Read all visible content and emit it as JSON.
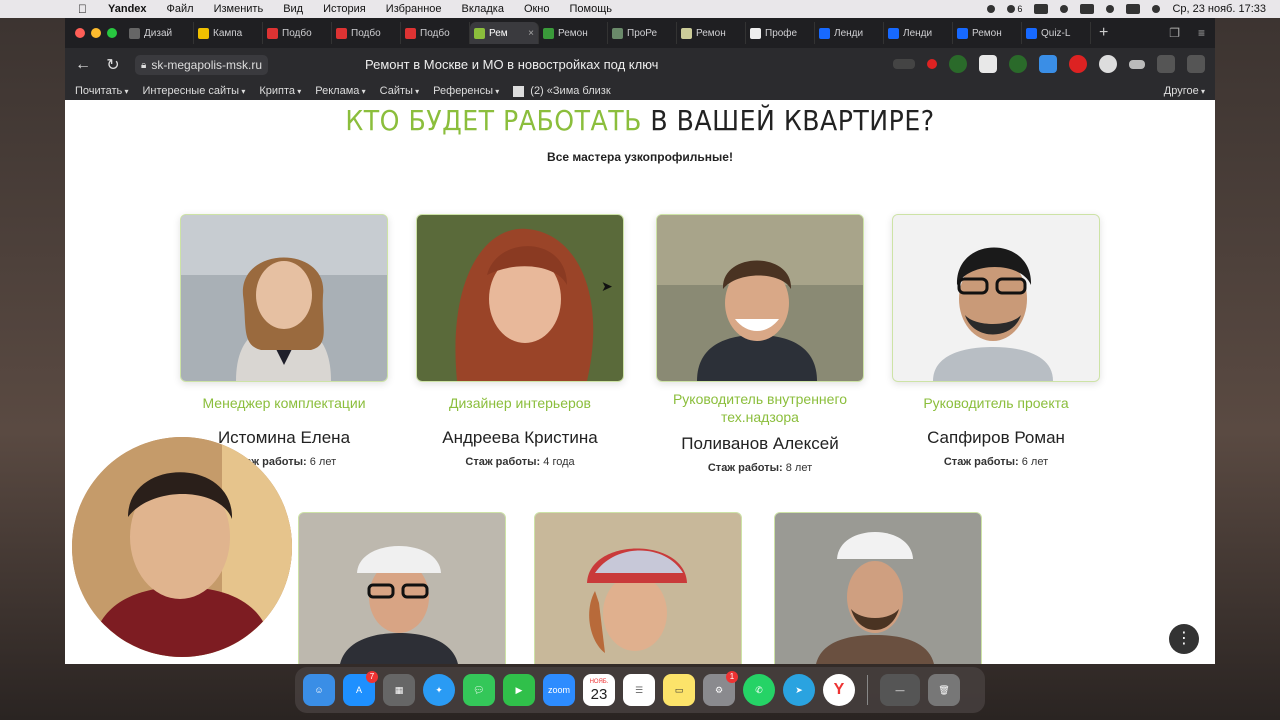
{
  "menubar": {
    "app_name": "Yandex",
    "items": [
      "Файл",
      "Изменить",
      "Вид",
      "История",
      "Избранное",
      "Вкладка",
      "Окно",
      "Помощь"
    ],
    "datetime": "Ср, 23 нояб.  17:33",
    "notification_count": "6"
  },
  "tabs": [
    {
      "label": "Дизай",
      "favicon_color": "#666"
    },
    {
      "label": "Кампа",
      "favicon_color": "#f0c000"
    },
    {
      "label": "Подбо",
      "favicon_color": "#d33"
    },
    {
      "label": "Подбо",
      "favicon_color": "#d33"
    },
    {
      "label": "Подбо",
      "favicon_color": "#d33"
    },
    {
      "label": "Рем",
      "favicon_color": "#8bbe3c",
      "active": true
    },
    {
      "label": "Ремон",
      "favicon_color": "#3a9a3a"
    },
    {
      "label": "ПроРе",
      "favicon_color": "#6a8a6a"
    },
    {
      "label": "Ремон",
      "favicon_color": "#cc9"
    },
    {
      "label": "Профе",
      "favicon_color": "#eee"
    },
    {
      "label": "Ленди",
      "favicon_color": "#1769ff"
    },
    {
      "label": "Ленди",
      "favicon_color": "#1769ff"
    },
    {
      "label": "Ремон",
      "favicon_color": "#1769ff"
    },
    {
      "label": "Quiz-L",
      "favicon_color": "#1769ff"
    }
  ],
  "address": {
    "url": "sk-megapolis-msk.ru",
    "page_title": "Ремонт в Москве и МО в новостройках под ключ"
  },
  "bookmarks": {
    "items": [
      "Почитать",
      "Интересные сайты",
      "Крипта",
      "Реклама",
      "Сайты",
      "Референсы"
    ],
    "pinned": "(2) «Зима близк",
    "other": "Другое"
  },
  "page": {
    "title_accent": "КТО БУДЕТ РАБОТАТЬ",
    "title_rest": "В ВАШЕЙ КВАРТИРЕ?",
    "subtitle": "Все мастера узкопрофильные!",
    "exp_label": "Стаж работы:",
    "team": [
      {
        "role": "Менеджер комплектации",
        "name": "Истомина Елена",
        "exp": "6 лет"
      },
      {
        "role": "Дизайнер интерьеров",
        "name": "Андреева Кристина",
        "exp": "4 года"
      },
      {
        "role": "Руководитель внутреннего тех.надзора",
        "name": "Поливанов Алексей",
        "exp": "8 лет"
      },
      {
        "role": "Руководитель проекта",
        "name": "Сапфиров Роман",
        "exp": "6 лет"
      }
    ]
  },
  "dock": {
    "appstore_badge": "7",
    "settings_badge": "1",
    "calendar_month": "НОЯБ.",
    "calendar_day": "23",
    "zoom_label": "zoom"
  }
}
